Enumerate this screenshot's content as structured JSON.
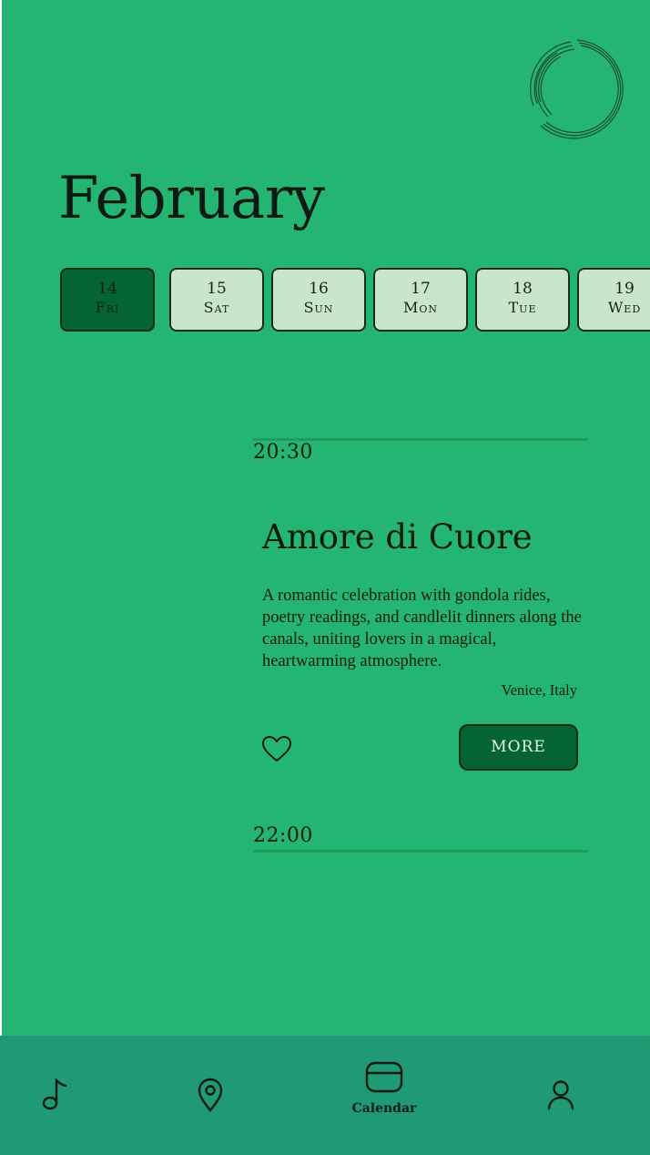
{
  "calendar": {
    "month": "February",
    "days": [
      {
        "num": "14",
        "name": "Fri",
        "selected": true
      },
      {
        "num": "15",
        "name": "Sat",
        "selected": false
      },
      {
        "num": "16",
        "name": "Sun",
        "selected": false
      },
      {
        "num": "17",
        "name": "Mon",
        "selected": false
      },
      {
        "num": "18",
        "name": "Tue",
        "selected": false
      },
      {
        "num": "19",
        "name": "Wed",
        "selected": false
      }
    ]
  },
  "timeline": {
    "slots": [
      "20:30",
      "22:00"
    ]
  },
  "event": {
    "title": "Amore di Cuore",
    "description": "A romantic celebration with gondola rides, poetry readings, and candlelit dinners along the canals, uniting lovers in a magical, heartwarming atmosphere.",
    "location": "Venice, Italy",
    "more_label": "MORE",
    "like_icon": "heart-icon"
  },
  "nav": {
    "items": [
      {
        "icon": "music-note-icon",
        "label": "",
        "active": false
      },
      {
        "icon": "map-pin-icon",
        "label": "",
        "active": false
      },
      {
        "icon": "calendar-icon",
        "label": "Calendar",
        "active": true
      },
      {
        "icon": "user-icon",
        "label": "",
        "active": false
      }
    ]
  },
  "colors": {
    "background": "#25b573",
    "selected_day": "#046532",
    "unselected_day": "#c9e6cd",
    "nav_bar": "#209a75",
    "button": "#046532"
  }
}
